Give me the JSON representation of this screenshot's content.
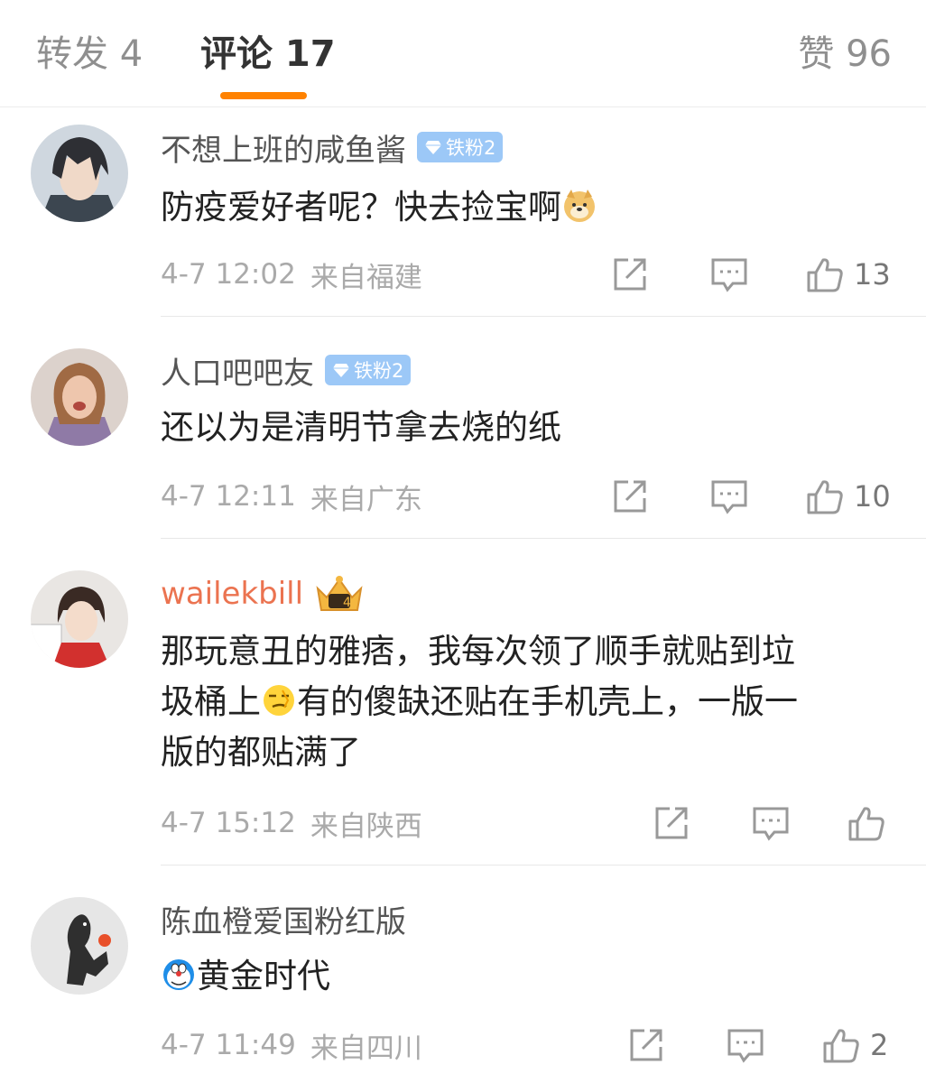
{
  "tabs": {
    "repost": "转发 4",
    "comments": "评论 17",
    "likes": "赞 96"
  },
  "accent_color": "#ff8200",
  "comments": [
    {
      "username": "不想上班的咸鱼酱",
      "badge": "铁粉2",
      "text": "防疫爱好者呢？快去捡宝啊",
      "emoji": "doge-emoji",
      "time": "4-7 12:02",
      "location": "来自福建",
      "likes": "13"
    },
    {
      "username": "人口吧吧友",
      "badge": "铁粉2",
      "text": "还以为是清明节拿去烧的纸",
      "time": "4-7 12:11",
      "location": "来自广东",
      "likes": "10"
    },
    {
      "username": "wailekbill",
      "vip": true,
      "text_line1": "那玩意丑的雅痞，我每次领了顺手就贴到垃",
      "text_line2a": "圾桶上",
      "emoji": "smirk-emoji",
      "text_line2b": "有的傻缺还贴在手机壳上，一版一",
      "text_line3": "版的都贴满了",
      "time": "4-7 15:12",
      "location": "来自陕西",
      "likes": ""
    },
    {
      "username": "陈血橙爱国粉红版",
      "emoji": "doraemon-emoji",
      "text": "黄金时代",
      "time": "4-7 11:49",
      "location": "来自四川",
      "likes": "2"
    }
  ]
}
